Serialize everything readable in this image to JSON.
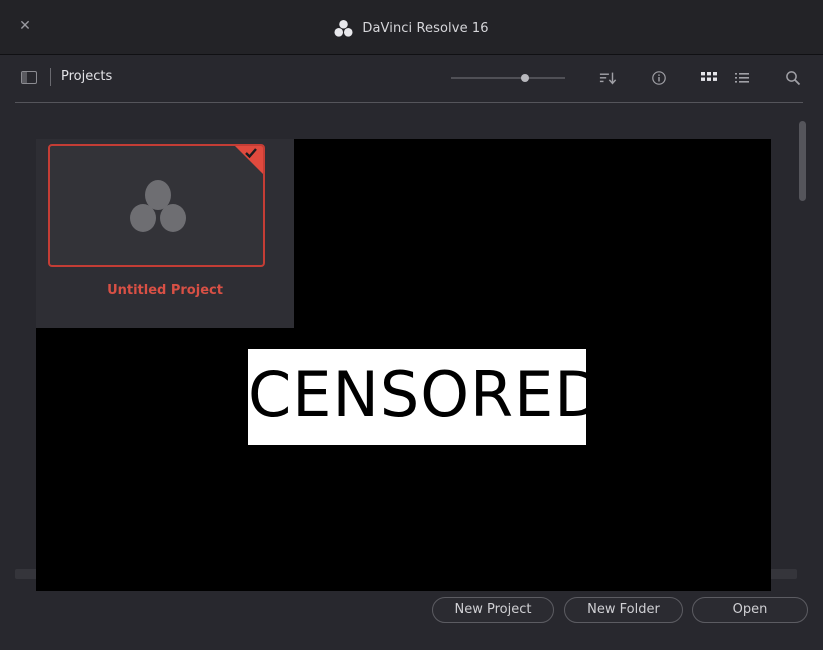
{
  "window": {
    "title": "DaVinci Resolve 16",
    "close_icon": "close-icon"
  },
  "toolbar": {
    "title": "Projects",
    "zoom_level": 0.65,
    "icons": [
      "sidebar-toggle-icon",
      "sort-icon",
      "info-icon",
      "grid-view-icon",
      "list-view-icon",
      "search-icon"
    ]
  },
  "projects": [
    {
      "name": "Untitled Project",
      "selected": true
    }
  ],
  "censor": {
    "label": "CENSORED"
  },
  "buttons": {
    "new_project": "New Project",
    "new_folder": "New Folder",
    "open": "Open"
  },
  "colors": {
    "accent": "#e04a3e",
    "selected_text": "#d85045",
    "background": "#28282e",
    "titlebar": "#232327"
  }
}
